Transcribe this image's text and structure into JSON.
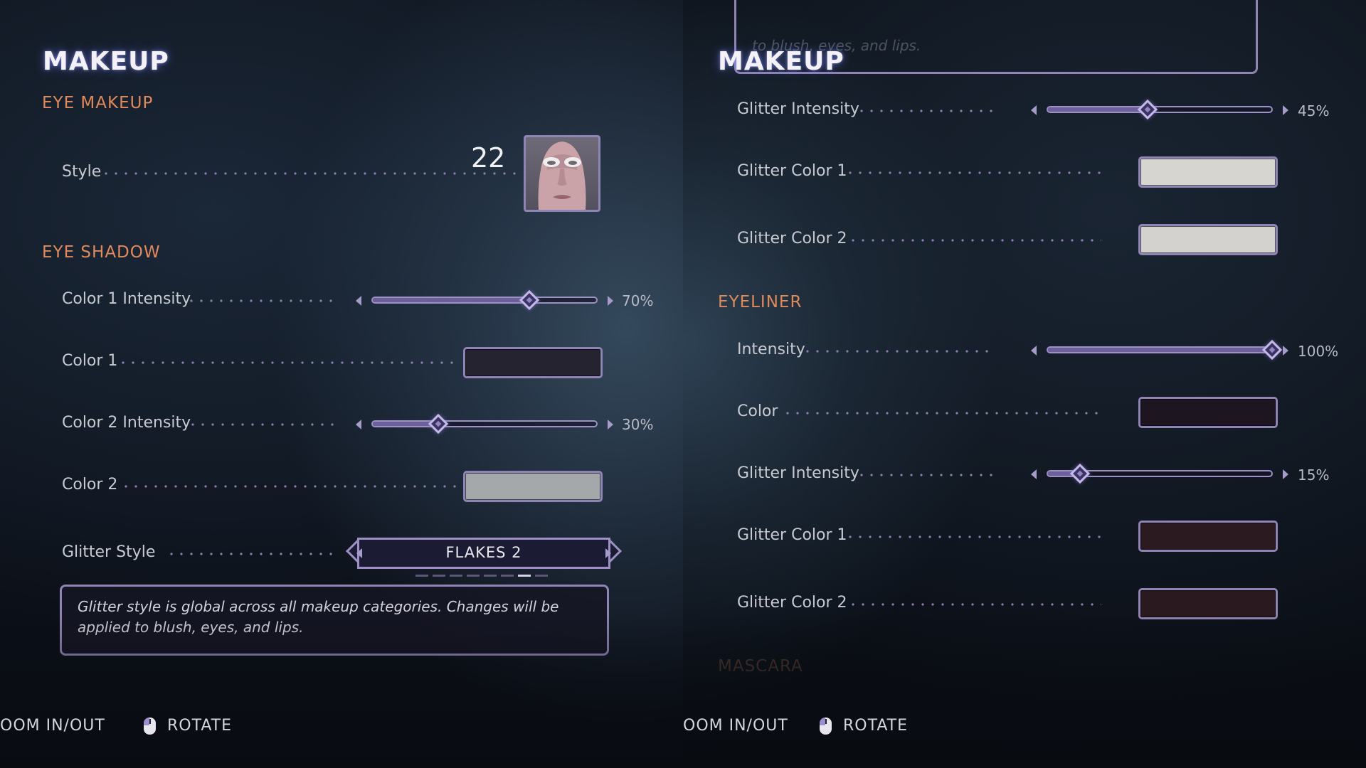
{
  "left": {
    "title": "MAKEUP",
    "eye_makeup": {
      "heading": "EYE MAKEUP",
      "style": {
        "label": "Style",
        "value": "22",
        "thumbnail_icon": "face-mask-icon"
      }
    },
    "eye_shadow": {
      "heading": "EYE SHADOW",
      "color1_intensity": {
        "label": "Color 1 Intensity",
        "value": 70,
        "display": "70%"
      },
      "color1": {
        "label": "Color 1",
        "color": "#25232f"
      },
      "color2_intensity": {
        "label": "Color 2 Intensity",
        "value": 30,
        "display": "30%"
      },
      "color2": {
        "label": "Color 2",
        "color": "#a4a8ab"
      },
      "glitter_style": {
        "label": "Glitter Style",
        "value": "FLAKES 2",
        "page_count": 8,
        "page_index": 6
      }
    },
    "tooltip": "Glitter style is global across all makeup categories. Changes will be applied to blush, eyes, and lips."
  },
  "right": {
    "title": "MAKEUP",
    "tooltip_fragment": "to blush, eyes, and lips.",
    "eye_shadow_cont": {
      "glitter_intensity": {
        "label": "Glitter Intensity",
        "value": 45,
        "display": "45%"
      },
      "glitter_color1": {
        "label": "Glitter Color 1",
        "color": "#d6d5d0"
      },
      "glitter_color2": {
        "label": "Glitter Color 2",
        "color": "#d3d2ce"
      }
    },
    "eyeliner": {
      "heading": "EYELINER",
      "intensity": {
        "label": "Intensity",
        "value": 100,
        "display": "100%"
      },
      "color": {
        "label": "Color",
        "color": "#1d1620"
      },
      "glitter_intensity": {
        "label": "Glitter Intensity",
        "value": 15,
        "display": "15%"
      },
      "glitter_color1": {
        "label": "Glitter Color 1",
        "color": "#2b1a20"
      },
      "glitter_color2": {
        "label": "Glitter Color 2",
        "color": "#2a191e"
      }
    },
    "mascara": {
      "heading": "MASCARA"
    }
  },
  "controls": {
    "zoom": "OOM IN/OUT",
    "rotate": "ROTATE",
    "rotate_icon": "mouse-icon"
  },
  "colors": {
    "accent": "#e0895a",
    "frame": "#9c90c4"
  }
}
